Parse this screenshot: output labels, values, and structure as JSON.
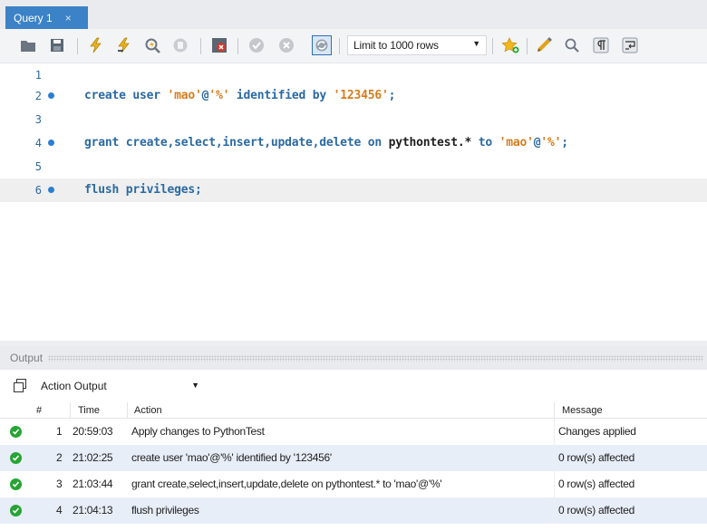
{
  "tab": {
    "label": "Query 1",
    "close_glyph": "×"
  },
  "toolbar": {
    "limit_label": "Limit to 1000 rows",
    "icons": [
      "open-folder-icon",
      "save-icon",
      "execute-icon",
      "execute-current-icon",
      "explain-icon",
      "stop-icon",
      "toggle-error-icon",
      "commit-icon",
      "rollback-icon",
      "autocommit-icon",
      "add-snippet-icon",
      "beautify-icon",
      "find-icon",
      "invisible-chars-icon",
      "wrap-lines-icon"
    ]
  },
  "editor": {
    "lines": [
      {
        "num": "1",
        "marker": false,
        "text": ""
      },
      {
        "num": "2",
        "marker": true,
        "tokens": [
          {
            "t": "create user ",
            "c": "kw"
          },
          {
            "t": "'mao'",
            "c": "str"
          },
          {
            "t": "@",
            "c": "kw"
          },
          {
            "t": "'%'",
            "c": "str"
          },
          {
            "t": " identified by ",
            "c": "kw"
          },
          {
            "t": "'123456'",
            "c": "str"
          },
          {
            "t": ";",
            "c": "kw"
          }
        ]
      },
      {
        "num": "3",
        "marker": false,
        "text": ""
      },
      {
        "num": "4",
        "marker": true,
        "tokens": [
          {
            "t": "grant create,select,insert,update,delete on ",
            "c": "kw"
          },
          {
            "t": "pythontest.*",
            "c": "plain"
          },
          {
            "t": " to ",
            "c": "kw"
          },
          {
            "t": "'mao'",
            "c": "str"
          },
          {
            "t": "@",
            "c": "kw"
          },
          {
            "t": "'%'",
            "c": "str"
          },
          {
            "t": ";",
            "c": "kw"
          }
        ]
      },
      {
        "num": "5",
        "marker": false,
        "text": ""
      },
      {
        "num": "6",
        "marker": true,
        "tokens": [
          {
            "t": "flush privileges;",
            "c": "kw"
          }
        ]
      }
    ]
  },
  "output": {
    "title": "Output",
    "selector": "Action Output",
    "columns": {
      "num": "#",
      "time": "Time",
      "action": "Action",
      "message": "Message"
    },
    "rows": [
      {
        "num": "1",
        "time": "20:59:03",
        "action": "Apply changes to PythonTest",
        "message": "Changes applied"
      },
      {
        "num": "2",
        "time": "21:02:25",
        "action": "create user 'mao'@'%' identified by '123456'",
        "message": "0 row(s) affected"
      },
      {
        "num": "3",
        "time": "21:03:44",
        "action": "grant create,select,insert,update,delete on pythontest.* to 'mao'@'%'",
        "message": "0 row(s) affected"
      },
      {
        "num": "4",
        "time": "21:04:13",
        "action": "flush privileges",
        "message": "0 row(s) affected"
      }
    ]
  },
  "colors": {
    "accent": "#3b82c7",
    "keyword": "#2b6aa3",
    "string": "#d47d1c",
    "success": "#27a434"
  }
}
